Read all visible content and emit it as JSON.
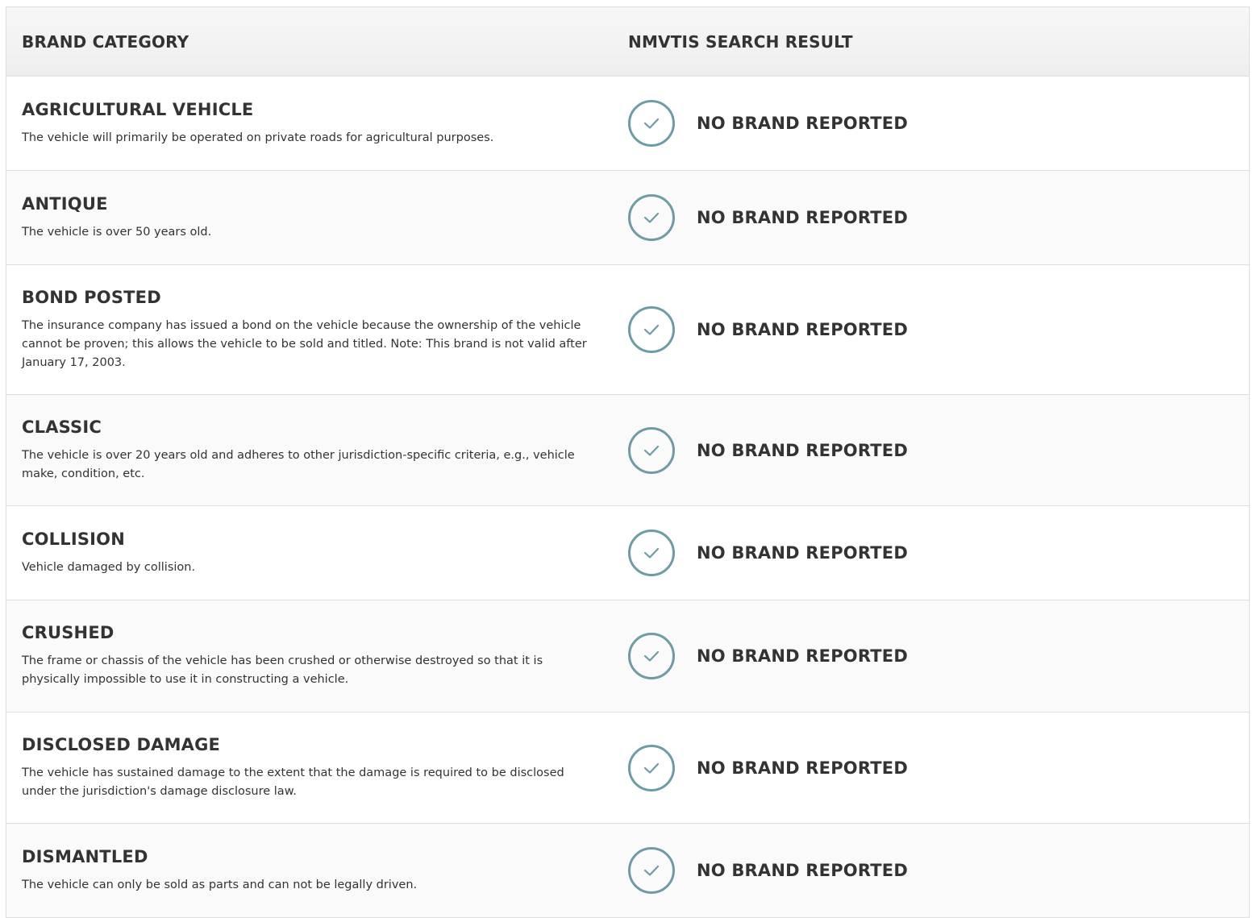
{
  "header": {
    "category_label": "BRAND CATEGORY",
    "result_label": "NMVTIS SEARCH RESULT"
  },
  "colors": {
    "check_accent": "#6f9ba5",
    "text": "#333333",
    "border": "#dedede"
  },
  "rows": [
    {
      "title": "AGRICULTURAL VEHICLE",
      "description": "The vehicle will primarily be operated on private roads for agricultural purposes.",
      "result": "NO BRAND REPORTED",
      "icon": "check-circle-icon"
    },
    {
      "title": "ANTIQUE",
      "description": "The vehicle is over 50 years old.",
      "result": "NO BRAND REPORTED",
      "icon": "check-circle-icon"
    },
    {
      "title": "BOND POSTED",
      "description": "The insurance company has issued a bond on the vehicle because the ownership of the vehicle cannot be proven; this allows the vehicle to be sold and titled. Note: This brand is not valid after January 17, 2003.",
      "result": "NO BRAND REPORTED",
      "icon": "check-circle-icon"
    },
    {
      "title": "CLASSIC",
      "description": "The vehicle is over 20 years old and adheres to other jurisdiction-specific criteria, e.g., vehicle make, condition, etc.",
      "result": "NO BRAND REPORTED",
      "icon": "check-circle-icon"
    },
    {
      "title": "COLLISION",
      "description": "Vehicle damaged by collision.",
      "result": "NO BRAND REPORTED",
      "icon": "check-circle-icon"
    },
    {
      "title": "CRUSHED",
      "description": "The frame or chassis of the vehicle has been crushed or otherwise destroyed so that it is physically impossible to use it in constructing a vehicle.",
      "result": "NO BRAND REPORTED",
      "icon": "check-circle-icon"
    },
    {
      "title": "DISCLOSED DAMAGE",
      "description": "The vehicle has sustained damage to the extent that the damage is required to be disclosed under the jurisdiction's damage disclosure law.",
      "result": "NO BRAND REPORTED",
      "icon": "check-circle-icon"
    },
    {
      "title": "DISMANTLED",
      "description": "The vehicle can only be sold as parts and can not be legally driven.",
      "result": "NO BRAND REPORTED",
      "icon": "check-circle-icon"
    }
  ]
}
